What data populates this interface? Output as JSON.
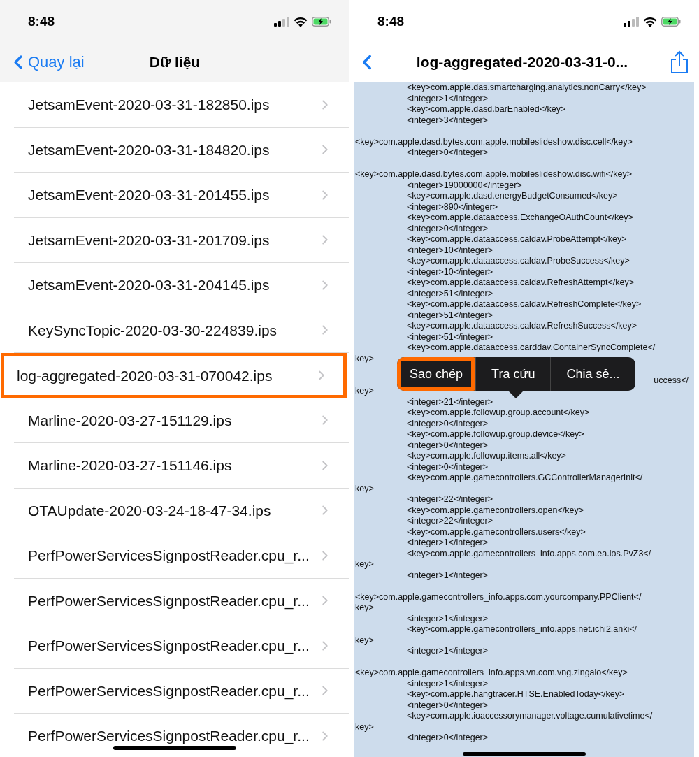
{
  "left_screen": {
    "status_bar": {
      "time": "8:48"
    },
    "nav_bar": {
      "back_label": "Quay lại",
      "title": "Dữ liệu"
    },
    "files": [
      {
        "name": "JetsamEvent-2020-03-31-182850.ips",
        "selected": false
      },
      {
        "name": "JetsamEvent-2020-03-31-184820.ips",
        "selected": false
      },
      {
        "name": "JetsamEvent-2020-03-31-201455.ips",
        "selected": false
      },
      {
        "name": "JetsamEvent-2020-03-31-201709.ips",
        "selected": false
      },
      {
        "name": "JetsamEvent-2020-03-31-204145.ips",
        "selected": false
      },
      {
        "name": "KeySyncTopic-2020-03-30-224839.ips",
        "selected": false
      },
      {
        "name": "log-aggregated-2020-03-31-070042.ips",
        "selected": true
      },
      {
        "name": "Marline-2020-03-27-151129.ips",
        "selected": false
      },
      {
        "name": "Marline-2020-03-27-151146.ips",
        "selected": false
      },
      {
        "name": "OTAUpdate-2020-03-24-18-47-34.ips",
        "selected": false
      },
      {
        "name": "PerfPowerServicesSignpostReader.cpu_r...",
        "selected": false
      },
      {
        "name": "PerfPowerServicesSignpostReader.cpu_r...",
        "selected": false
      },
      {
        "name": "PerfPowerServicesSignpostReader.cpu_r...",
        "selected": false
      },
      {
        "name": "PerfPowerServicesSignpostReader.cpu_r...",
        "selected": false
      },
      {
        "name": "PerfPowerServicesSignpostReader.cpu_r...",
        "selected": false
      }
    ]
  },
  "right_screen": {
    "status_bar": {
      "time": "8:48"
    },
    "nav_bar": {
      "title": "log-aggregated-2020-03-31-0..."
    },
    "lines": [
      {
        "kind": "indented",
        "text": "<key>com.apple.das.smartcharging.analytics.nonCarry</key>"
      },
      {
        "kind": "indented",
        "text": "<integer>1</integer>"
      },
      {
        "kind": "indented",
        "text": "<key>com.apple.dasd.barEnabled</key>"
      },
      {
        "kind": "indented",
        "text": "<integer>3</integer>"
      },
      {
        "kind": "blank"
      },
      {
        "kind": "flush",
        "text": "<key>com.apple.dasd.bytes.com.apple.mobileslideshow.disc.cell</key>"
      },
      {
        "kind": "indented",
        "text": "<integer>0</integer>"
      },
      {
        "kind": "blank"
      },
      {
        "kind": "flush",
        "text": "<key>com.apple.dasd.bytes.com.apple.mobileslideshow.disc.wifi</key>"
      },
      {
        "kind": "indented",
        "text": "<integer>19000000</integer>"
      },
      {
        "kind": "indented",
        "text": "<key>com.apple.dasd.energyBudgetConsumed</key>"
      },
      {
        "kind": "indented",
        "text": "<integer>890</integer>"
      },
      {
        "kind": "indented",
        "text": "<key>com.apple.dataaccess.ExchangeOAuthCount</key>"
      },
      {
        "kind": "indented",
        "text": "<integer>0</integer>"
      },
      {
        "kind": "indented",
        "text": "<key>com.apple.dataaccess.caldav.ProbeAttempt</key>"
      },
      {
        "kind": "indented",
        "text": "<integer>10</integer>"
      },
      {
        "kind": "indented",
        "text": "<key>com.apple.dataaccess.caldav.ProbeSuccess</key>"
      },
      {
        "kind": "indented",
        "text": "<integer>10</integer>"
      },
      {
        "kind": "indented",
        "text": "<key>com.apple.dataaccess.caldav.RefreshAttempt</key>"
      },
      {
        "kind": "indented",
        "text": "<integer>51</integer>"
      },
      {
        "kind": "indented",
        "text": "<key>com.apple.dataaccess.caldav.RefreshComplete</key>"
      },
      {
        "kind": "indented",
        "text": "<integer>51</integer>"
      },
      {
        "kind": "indented",
        "text": "<key>com.apple.dataaccess.caldav.RefreshSuccess</key>"
      },
      {
        "kind": "indented",
        "text": "<integer>51</integer>"
      },
      {
        "kind": "indented",
        "text": "<key>com.apple.dataaccess.carddav.ContainerSyncComplete</"
      },
      {
        "kind": "flush",
        "text": "key>"
      },
      {
        "kind": "blank"
      },
      {
        "kind": "tail",
        "text": "uccess</"
      },
      {
        "kind": "flush",
        "text": "key>"
      },
      {
        "kind": "indented",
        "text": "<integer>21</integer>"
      },
      {
        "kind": "indented",
        "text": "<key>com.apple.followup.group.account</key>"
      },
      {
        "kind": "indented",
        "text": "<integer>0</integer>"
      },
      {
        "kind": "indented",
        "text": "<key>com.apple.followup.group.device</key>"
      },
      {
        "kind": "indented",
        "text": "<integer>0</integer>"
      },
      {
        "kind": "indented",
        "text": "<key>com.apple.followup.items.all</key>"
      },
      {
        "kind": "indented",
        "text": "<integer>0</integer>"
      },
      {
        "kind": "indented",
        "text": "<key>com.apple.gamecontrollers.GCControllerManagerInit</"
      },
      {
        "kind": "flush",
        "text": "key>"
      },
      {
        "kind": "indented",
        "text": "<integer>22</integer>"
      },
      {
        "kind": "indented",
        "text": "<key>com.apple.gamecontrollers.open</key>"
      },
      {
        "kind": "indented",
        "text": "<integer>22</integer>"
      },
      {
        "kind": "indented",
        "text": "<key>com.apple.gamecontrollers.users</key>"
      },
      {
        "kind": "indented",
        "text": "<integer>1</integer>"
      },
      {
        "kind": "indented",
        "text": "<key>com.apple.gamecontrollers_info.apps.com.ea.ios.PvZ3</"
      },
      {
        "kind": "flush",
        "text": "key>"
      },
      {
        "kind": "indented",
        "text": "<integer>1</integer>"
      },
      {
        "kind": "blank"
      },
      {
        "kind": "flush",
        "text": "<key>com.apple.gamecontrollers_info.apps.com.yourcompany.PPClient</"
      },
      {
        "kind": "flush",
        "text": "key>"
      },
      {
        "kind": "indented",
        "text": "<integer>1</integer>"
      },
      {
        "kind": "indented",
        "text": "<key>com.apple.gamecontrollers_info.apps.net.ichi2.anki</"
      },
      {
        "kind": "flush",
        "text": "key>"
      },
      {
        "kind": "indented",
        "text": "<integer>1</integer>"
      },
      {
        "kind": "blank"
      },
      {
        "kind": "flush",
        "text": "<key>com.apple.gamecontrollers_info.apps.vn.com.vng.zingalo</key>"
      },
      {
        "kind": "indented",
        "text": "<integer>1</integer>"
      },
      {
        "kind": "indented",
        "text": "<key>com.apple.hangtracer.HTSE.EnabledToday</key>"
      },
      {
        "kind": "indented",
        "text": "<integer>0</integer>"
      },
      {
        "kind": "indented",
        "text": "<key>com.apple.ioaccessorymanager.voltage.cumulativetime</"
      },
      {
        "kind": "flush",
        "text": "key>"
      },
      {
        "kind": "indented",
        "text": "<integer>0</integer>"
      }
    ],
    "edit_menu": [
      {
        "label": "Sao chép",
        "highlighted": true
      },
      {
        "label": "Tra cứu",
        "highlighted": false
      },
      {
        "label": "Chia sẻ...",
        "highlighted": false
      }
    ]
  }
}
